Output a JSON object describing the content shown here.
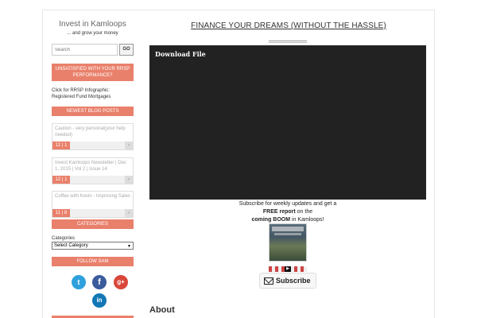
{
  "sidebar": {
    "site_title": "Invest in Kamloops",
    "tagline": "... and grow your money",
    "search": {
      "placeholder": "Search",
      "button": "GO"
    },
    "rrsp_banner": "UNSATISFIED WITH YOUR RRSP PERFORMANCE?",
    "infographic_link": "Click for RRSP Infographic: Registered Fund Mortgages",
    "newest_posts_heading": "NEWEST BLOG POSTS",
    "posts": [
      {
        "title": "Caution - very personal(your help needed)",
        "date": "12 | 1"
      },
      {
        "title": "Invest Kamloops Newsletter | Dec 1, 2015 | Vol 2 | Issue 14",
        "date": "12 | 1"
      },
      {
        "title": "Coffee with Kevin - Improving Sales",
        "date": "11 | 8"
      }
    ],
    "post_arrow": "›",
    "categories_heading": "CATEGORIES",
    "categories_label": "Categories",
    "categories_select": "Select Category",
    "follow_heading": "FOLLOW SAM",
    "social": {
      "twitter": "t",
      "facebook": "f",
      "googleplus": "g+",
      "linkedin": "in"
    }
  },
  "main": {
    "title": "FINANCE YOUR DREAMS (WITHOUT THE HASSLE)",
    "video_label": "Download File",
    "subscribe_line1": "Subscribe for weekly updates and get a",
    "subscribe_bold1": "FREE report",
    "subscribe_line2": " on the",
    "subscribe_bold2": "coming BOOM",
    "subscribe_line3": " in Kamloops!",
    "subscribe_button": "Subscribe",
    "about_heading": "About"
  },
  "colors": {
    "accent": "#e9806b",
    "video_bg": "#222222"
  }
}
